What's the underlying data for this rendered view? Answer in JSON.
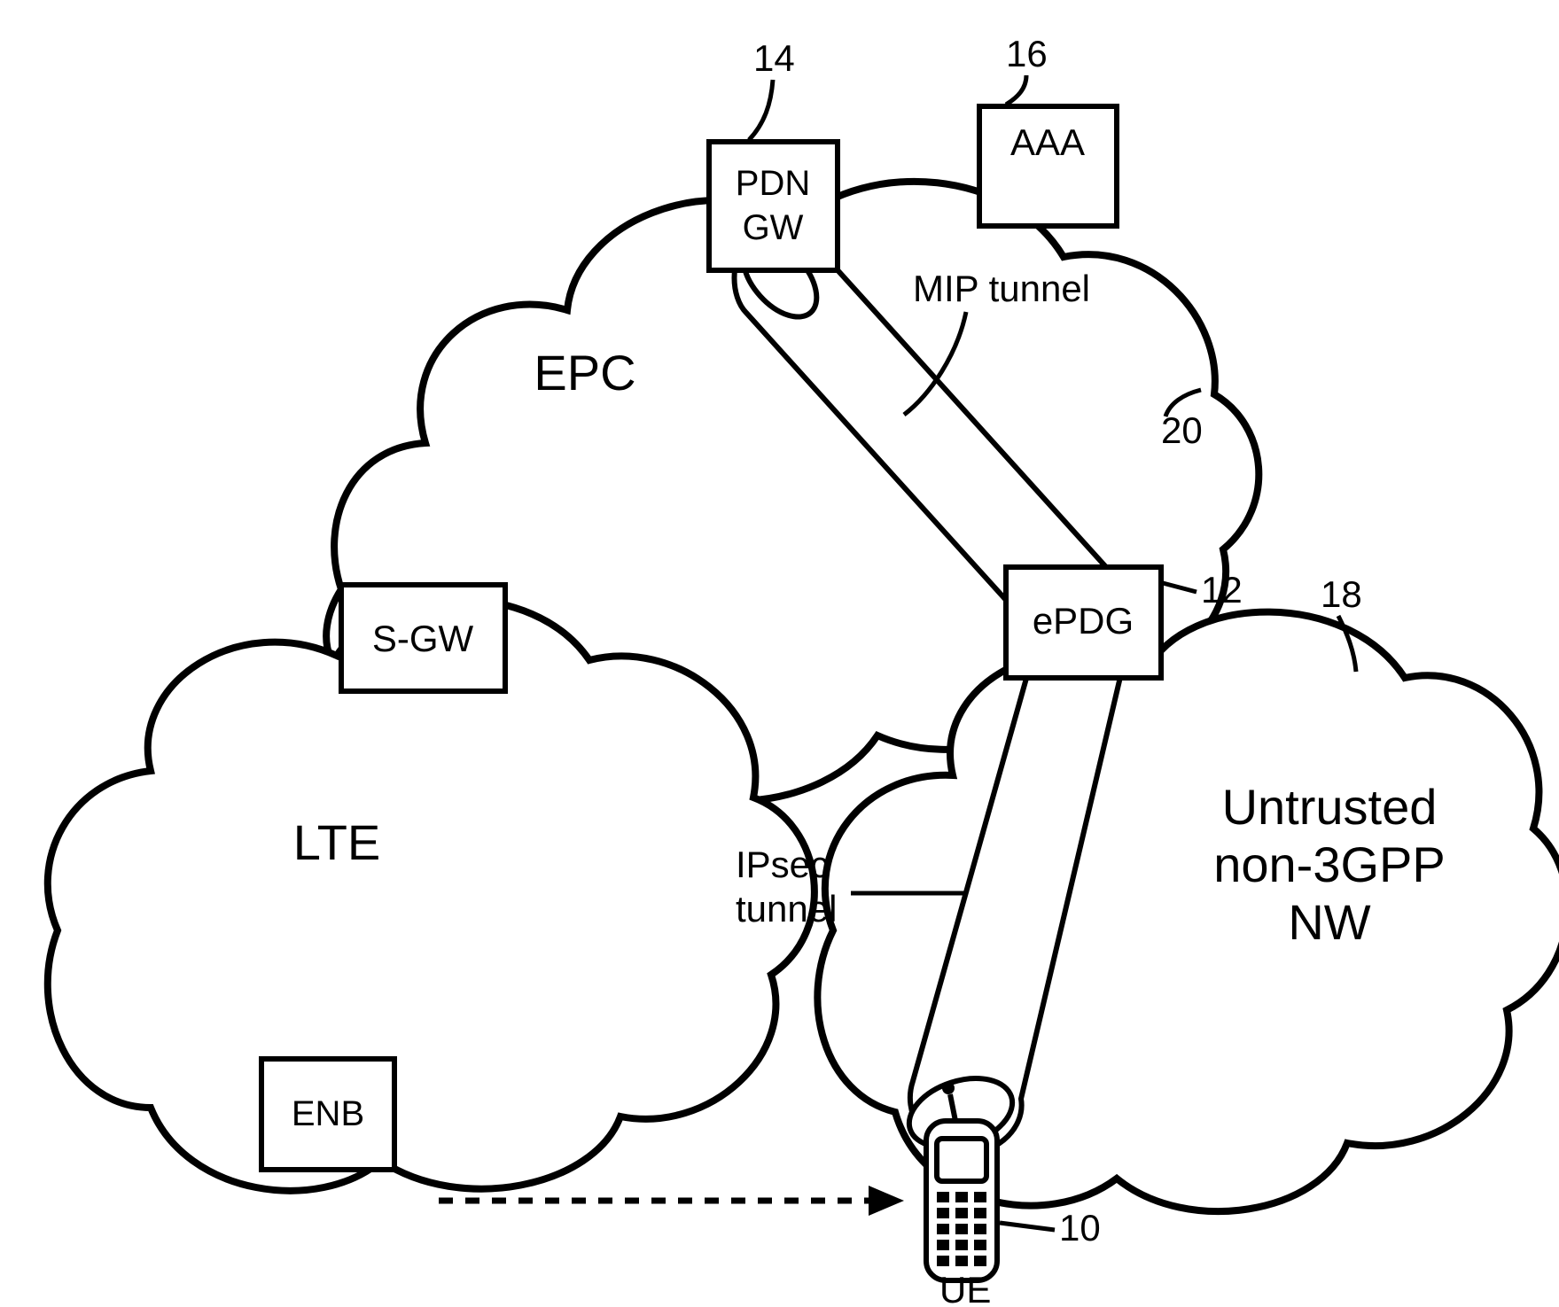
{
  "clouds": {
    "epc": {
      "label": "EPC",
      "ref": "20"
    },
    "lte": {
      "label": "LTE"
    },
    "untrusted": {
      "line1": "Untrusted",
      "line2": "non-3GPP",
      "line3": "NW",
      "ref": "18"
    }
  },
  "boxes": {
    "pdn_gw": {
      "line1": "PDN",
      "line2": "GW",
      "ref": "14"
    },
    "aaa": {
      "label": "AAA",
      "ref": "16"
    },
    "sgw": {
      "label": "S-GW"
    },
    "epdg": {
      "label": "ePDG",
      "ref": "12"
    },
    "enb": {
      "label": "ENB"
    }
  },
  "tunnels": {
    "mip": {
      "label": "MIP tunnel"
    },
    "ipsec": {
      "line1": "IPsec",
      "line2": "tunnel"
    }
  },
  "ue": {
    "label": "UE",
    "ref": "10"
  }
}
